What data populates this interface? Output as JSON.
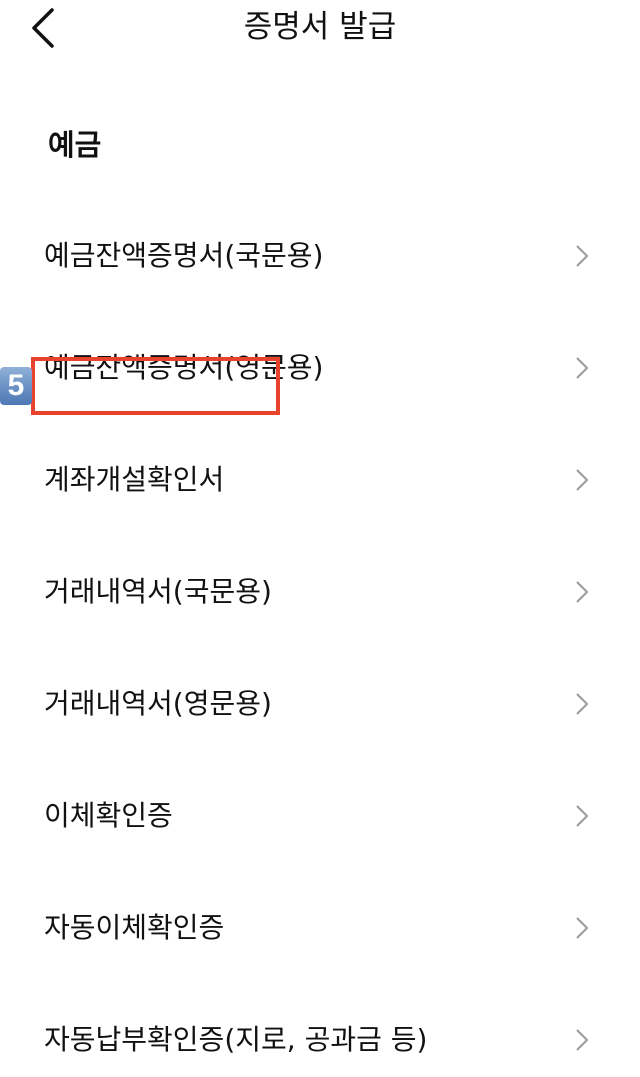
{
  "header": {
    "title": "증명서 발급",
    "back_icon": "chevron-left-icon"
  },
  "section": {
    "title": "예금"
  },
  "items": [
    {
      "label": "예금잔액증명서(국문용)"
    },
    {
      "label": "예금잔액증명서(영문용)"
    },
    {
      "label": "계좌개설확인서"
    },
    {
      "label": "거래내역서(국문용)"
    },
    {
      "label": "거래내역서(영문용)"
    },
    {
      "label": "이체확인증"
    },
    {
      "label": "자동이체확인증"
    },
    {
      "label": "자동납부확인증(지로, 공과금 등)"
    }
  ],
  "annotation": {
    "step_number": "5",
    "highlight_color": "#e8412c",
    "badge_color": "#5b82bc"
  }
}
